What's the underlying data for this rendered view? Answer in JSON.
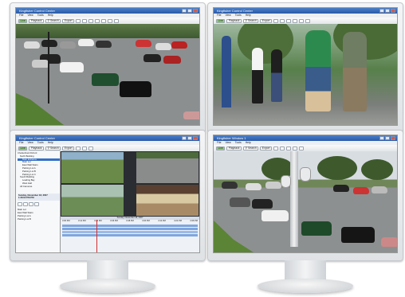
{
  "monitors": [
    {
      "title": "Kingfisher Control Center",
      "menu": [
        "File",
        "View",
        "Tools",
        "Help"
      ],
      "toolbar": {
        "live": "Live",
        "playback": "Playback",
        "search": "Search",
        "export": "Export"
      },
      "scene": "parking-lot-wide"
    },
    {
      "title": "Kingfisher Control Center",
      "menu": [
        "File",
        "View",
        "Tools",
        "Help"
      ],
      "toolbar": {
        "live": "Live",
        "playback": "Playback",
        "search": "Search",
        "export": "Export"
      },
      "scene": "pedestrians"
    },
    {
      "title": "Kingfisher Control Center",
      "menu": [
        "File",
        "View",
        "Tools",
        "Help"
      ],
      "toolbar": {
        "live": "Live",
        "playback": "Playback",
        "search": "Search",
        "export": "Export"
      },
      "tree": [
        "Cheltenham/Oxford",
        "North Building",
        "Main Entrance",
        "Main Lot",
        "East Wall Stairs",
        "Parking Lot A",
        "Parking Lot B",
        "Parking Lot C",
        "South Building",
        "Loading Bay",
        "West Hall",
        "All Cameras"
      ],
      "panel_date": "Sunday, November 18, 2007",
      "panel_time": "1:28:02 PM PM",
      "timeline_header": "Sunday, November 18, 2007",
      "timeline_times": [
        "3:00 PM",
        "3:12 PM",
        "3:24 PM",
        "3:36 PM",
        "3:48 PM",
        "4:00 PM",
        "4:12 PM",
        "4:24 PM",
        "4:36 PM"
      ],
      "timeline_rows": [
        "Main Lot",
        "East Wall Stairs",
        "Parking Lot A",
        "Parking Lot B"
      ]
    },
    {
      "title": "Kingfisher Window 1",
      "menu": [
        "File",
        "View",
        "Tools",
        "Help"
      ],
      "toolbar": {
        "live": "Live",
        "playback": "Playback",
        "search": "Search",
        "export": "Export"
      },
      "scene": "parking-lot-camera"
    }
  ],
  "colors": {
    "titlebar": "#2b5aa8",
    "playhead": "#d23030",
    "timeline_bar": "#7ea6e0"
  }
}
